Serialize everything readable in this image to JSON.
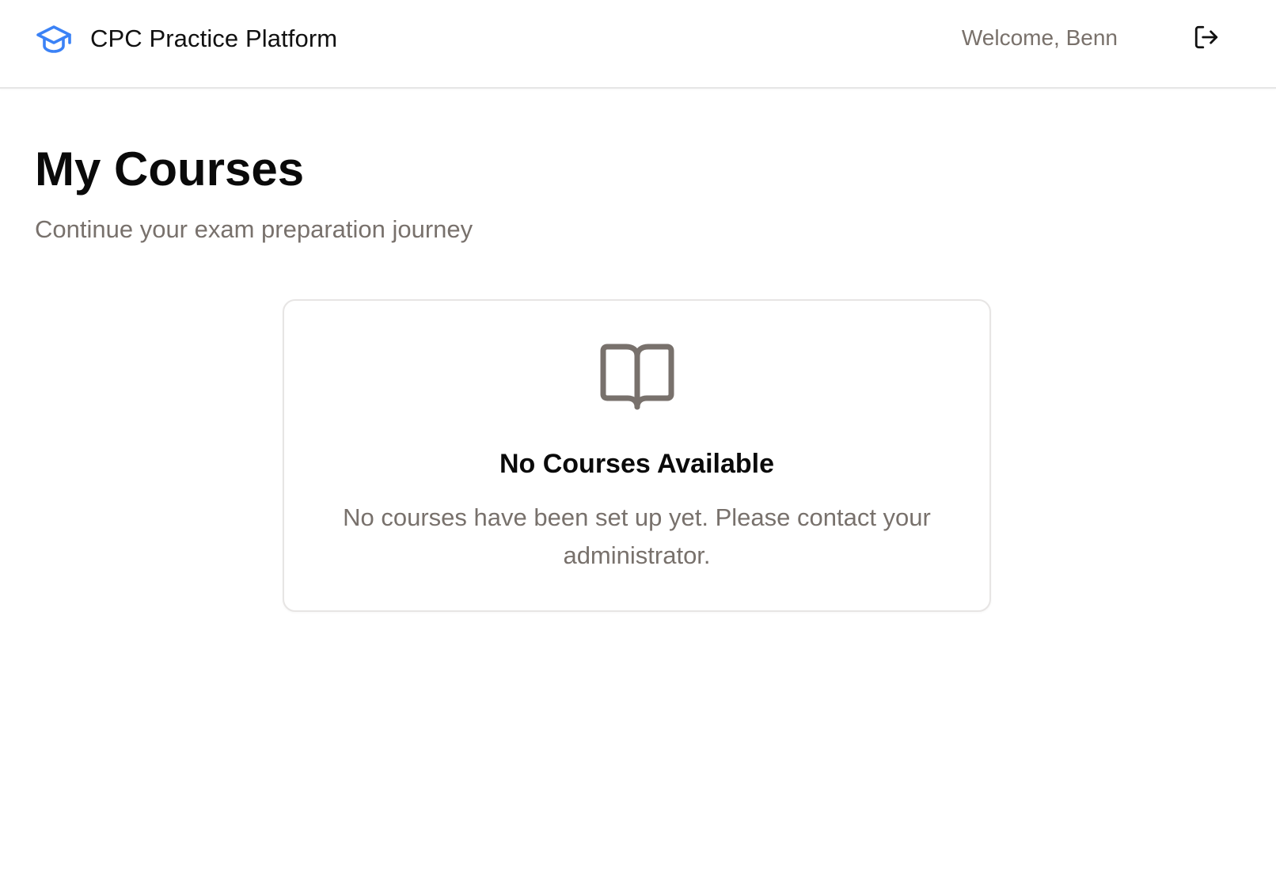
{
  "header": {
    "brand_title": "CPC Practice Platform",
    "brand_icon": "graduation-cap-icon",
    "welcome_text": "Welcome, Benn",
    "logout_icon": "log-out-icon"
  },
  "main": {
    "title": "My Courses",
    "subtitle": "Continue your exam preparation journey"
  },
  "empty_state": {
    "icon": "book-open-icon",
    "title": "No Courses Available",
    "message": "No courses have been set up yet. Please contact your administrator."
  },
  "colors": {
    "accent": "#3b82f6",
    "muted_text": "#78716c",
    "border": "#e7e5e4",
    "icon_muted": "#78716c"
  }
}
